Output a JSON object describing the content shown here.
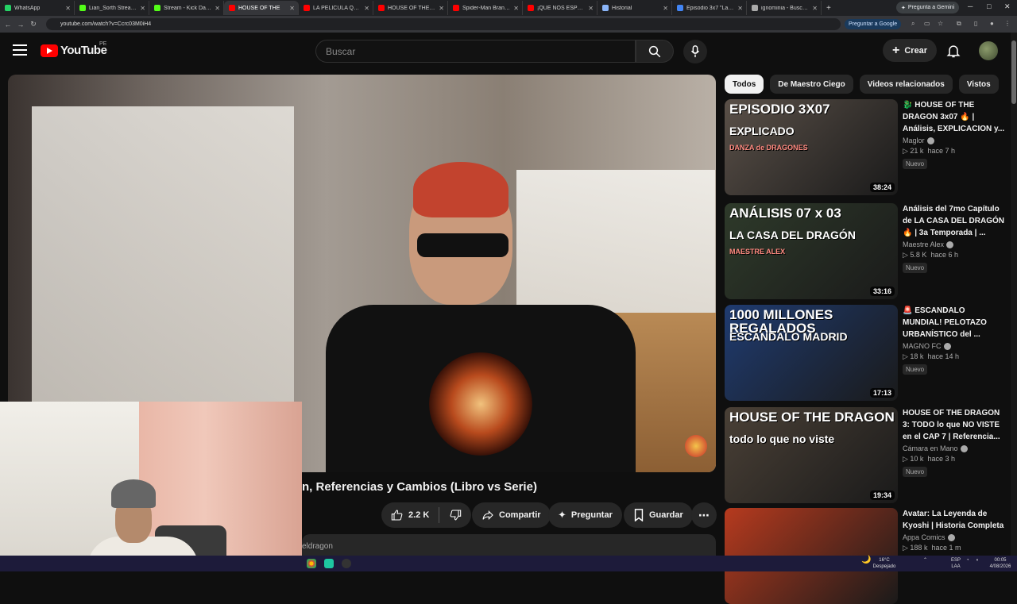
{
  "browser": {
    "tabs": [
      {
        "label": "WhatsApp",
        "color": "#25d366",
        "active": false
      },
      {
        "label": "Lian_Sorth Stream - W...",
        "color": "#53fc18",
        "active": false
      },
      {
        "label": "Stream - Kick Dashbo...",
        "color": "#53fc18",
        "active": false
      },
      {
        "label": "HOUSE OF THE",
        "color": "#ff0000",
        "active": true
      },
      {
        "label": "LA PELÍCULA QUE TOD...",
        "color": "#ff0000",
        "active": false
      },
      {
        "label": "HOUSE OF THE DRAGO...",
        "color": "#ff0000",
        "active": false
      },
      {
        "label": "Spider-Man Brand New...",
        "color": "#ff0000",
        "active": false
      },
      {
        "label": "¡QUE NOS ESPERA...",
        "color": "#ff0000",
        "active": false
      },
      {
        "label": "Historial",
        "color": "#8ab4f8",
        "active": false
      },
      {
        "label": "Episodio 3x7 \"La casa...",
        "color": "#4285f4",
        "active": false
      },
      {
        "label": "ignominia - Buscar con...",
        "color": "#aaaaaa",
        "active": false
      }
    ],
    "new_tab": "+",
    "gemini_button": "Pregunta a Gemini",
    "url": "youtube.com/watch?v=Ccrc03M0iH4",
    "ask_google": "Preguntar a Google"
  },
  "header": {
    "logo": "YouTube",
    "country": "PE",
    "search_placeholder": "Buscar",
    "create_label": "Crear"
  },
  "video": {
    "title": "n, Referencias y Cambios (Libro vs Serie)",
    "likes": "2.2 K",
    "share": "Compartir",
    "ask": "Preguntar",
    "save": "Guardar",
    "desc_fragment": "eldragon"
  },
  "chips": [
    "Todos",
    "De Maestro Ciego",
    "Videos relacionados",
    "Vistos"
  ],
  "recommendations": [
    {
      "title": "🐉 HOUSE OF THE DRAGON 3x07 🔥 | Análisis, EXPLICACION y...",
      "channel": "Maglor",
      "views": "21 k",
      "age": "hace 7 h",
      "badge": "Nuevo",
      "duration": "38:24",
      "thumb_text1": "EPISODIO 3X07",
      "thumb_text2": "EXPLICADO",
      "thumb_text3": "DANZA de DRAGONES",
      "bg": "#5a5048"
    },
    {
      "title": "Análisis del 7mo Capítulo de LA CASA DEL DRAGÓN 🔥 | 3a Temporada | ...",
      "channel": "Maestre Alex",
      "views": "5.8 K",
      "age": "hace 6 h",
      "badge": "Nuevo",
      "duration": "33:16",
      "thumb_text1": "ANÁLISIS 07 x 03",
      "thumb_text2": "LA CASA DEL DRAGÓN",
      "thumb_text3": "MAESTRE ALEX",
      "bg": "#2e3a2a"
    },
    {
      "title": "🚨 ESCANDALO MUNDIAL! PELOTAZO URBANÍSTICO del ...",
      "channel": "MAGNO FC",
      "views": "18 k",
      "age": "hace 14 h",
      "badge": "Nuevo",
      "duration": "17:13",
      "thumb_text1": "1000 MILLONES REGALADOS",
      "thumb_text2": "ESCANDALO MADRID",
      "thumb_text3": "",
      "bg": "#1f3b70"
    },
    {
      "title": "HOUSE OF THE DRAGON 3: TODO lo que NO VISTE en el CAP 7 | Referencia...",
      "channel": "Cámara en Mano",
      "views": "10 k",
      "age": "hace 3 h",
      "badge": "Nuevo",
      "duration": "19:34",
      "thumb_text1": "HOUSE OF THE DRAGON",
      "thumb_text2": "todo lo que no viste",
      "thumb_text3": "",
      "bg": "#4a4036"
    },
    {
      "title": "Avatar: La Leyenda de Kyoshi | Historia Completa",
      "channel": "Appa Comics",
      "views": "188 k",
      "age": "hace 1 m",
      "badge": "",
      "duration": "",
      "thumb_text1": "",
      "thumb_text2": "",
      "thumb_text3": "",
      "bg": "#b63a1e"
    }
  ],
  "taskbar": {
    "weather": "16°C Despejado",
    "lang": "ESP LAA",
    "time": "00:05",
    "date": "4/08/2026"
  }
}
